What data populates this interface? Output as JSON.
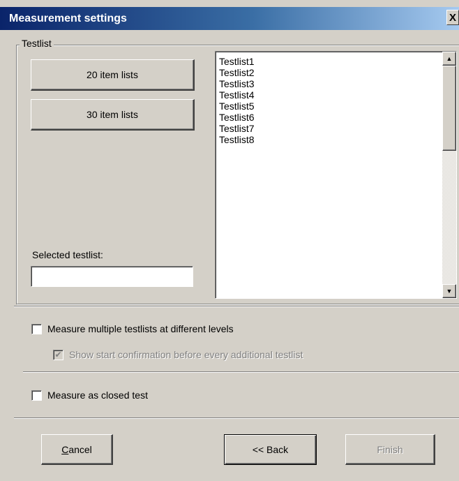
{
  "window": {
    "title": "Measurement settings",
    "close_label": "X"
  },
  "testlist_group": {
    "legend": "Testlist",
    "btn_20": "20 item lists",
    "btn_30": "30 item lists",
    "selected_label": "Selected testlist:",
    "selected_value": "",
    "items": [
      "Testlist1",
      "Testlist2",
      "Testlist3",
      "Testlist4",
      "Testlist5",
      "Testlist6",
      "Testlist7",
      "Testlist8"
    ],
    "scroll_up": "▲",
    "scroll_down": "▼"
  },
  "options": {
    "multi_levels": {
      "label": "Measure multiple testlists at different levels",
      "checked": false
    },
    "start_confirm": {
      "label": "Show start confirmation before every additional testlist",
      "checked": true,
      "disabled": true
    },
    "closed_test": {
      "label": "Measure as closed test",
      "checked": false
    }
  },
  "footer": {
    "cancel_rest": "ancel",
    "cancel_mnemonic": "C",
    "back": "<< Back",
    "finish": "Finish"
  }
}
